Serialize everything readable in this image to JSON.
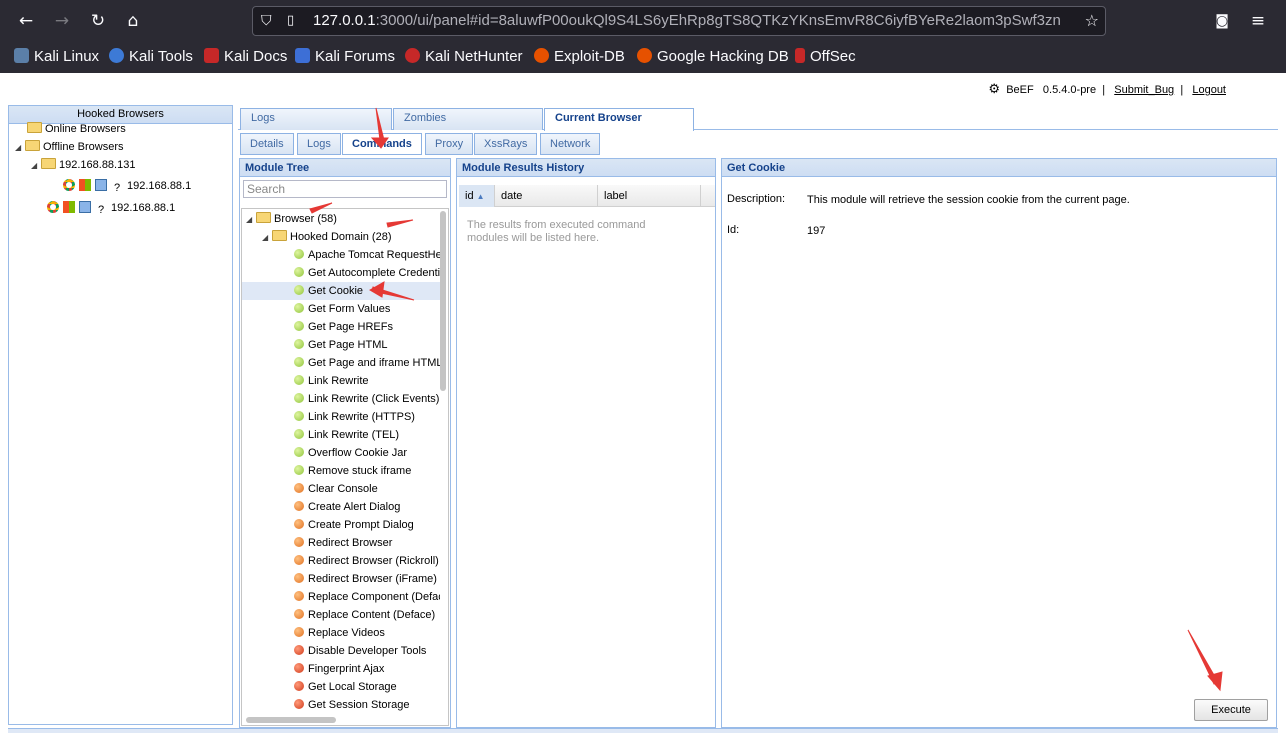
{
  "browser": {
    "url_host": "127.0.0.1",
    "url_rest": ":3000/ui/panel#id=8aluwfP00oukQl9S4LS6yEhRp8gTS8QTKzYKnsEmvR8C6iyfBYeRe2laom3pSwf3zn",
    "bookmarks": [
      "Kali Linux",
      "Kali Tools",
      "Kali Docs",
      "Kali Forums",
      "Kali NetHunter",
      "Exploit-DB",
      "Google Hacking DB",
      "OffSec"
    ],
    "icons": {
      "back": "back-arrow-icon",
      "forward": "forward-arrow-icon",
      "reload": "reload-icon",
      "home": "home-icon",
      "pocket": "pocket-icon",
      "menu": "hamburger-menu-icon"
    }
  },
  "header": {
    "app": "BeEF",
    "version": "0.5.4.0-pre",
    "sep": "|",
    "submit_bug": "Submit_Bug",
    "logout": "Logout"
  },
  "left": {
    "title": "Hooked Browsers",
    "online": "Online Browsers",
    "offline": "Offline Browsers",
    "host": "192.168.88.131",
    "browser1": "192.168.88.1",
    "browser2": "192.168.88.1"
  },
  "tabs": [
    "Logs",
    "Zombies",
    "Current Browser"
  ],
  "subtabs": [
    "Details",
    "Logs",
    "Commands",
    "Proxy",
    "XssRays",
    "Network"
  ],
  "module_tree": {
    "title": "Module Tree",
    "search_placeholder": "Search",
    "root": "Browser (58)",
    "domain": "Hooked Domain (28)",
    "modules": [
      {
        "label": "Apache Tomcat RequestHeaderCookieFilter",
        "color": "green"
      },
      {
        "label": "Get Autocomplete Credentials",
        "color": "green"
      },
      {
        "label": "Get Cookie",
        "color": "green"
      },
      {
        "label": "Get Form Values",
        "color": "green"
      },
      {
        "label": "Get Page HREFs",
        "color": "green"
      },
      {
        "label": "Get Page HTML",
        "color": "green"
      },
      {
        "label": "Get Page and iframe HTML",
        "color": "green"
      },
      {
        "label": "Link Rewrite",
        "color": "green"
      },
      {
        "label": "Link Rewrite (Click Events)",
        "color": "green"
      },
      {
        "label": "Link Rewrite (HTTPS)",
        "color": "green"
      },
      {
        "label": "Link Rewrite (TEL)",
        "color": "green"
      },
      {
        "label": "Overflow Cookie Jar",
        "color": "green"
      },
      {
        "label": "Remove stuck iframe",
        "color": "green"
      },
      {
        "label": "Clear Console",
        "color": "orange"
      },
      {
        "label": "Create Alert Dialog",
        "color": "orange"
      },
      {
        "label": "Create Prompt Dialog",
        "color": "orange"
      },
      {
        "label": "Redirect Browser",
        "color": "orange"
      },
      {
        "label": "Redirect Browser (Rickroll)",
        "color": "orange"
      },
      {
        "label": "Redirect Browser (iFrame)",
        "color": "orange"
      },
      {
        "label": "Replace Component (Deface)",
        "color": "orange"
      },
      {
        "label": "Replace Content (Deface)",
        "color": "orange"
      },
      {
        "label": "Replace Videos",
        "color": "orange"
      },
      {
        "label": "Disable Developer Tools",
        "color": "red"
      },
      {
        "label": "Fingerprint Ajax",
        "color": "red"
      },
      {
        "label": "Get Local Storage",
        "color": "red"
      },
      {
        "label": "Get Session Storage",
        "color": "red"
      }
    ],
    "selected": "Get Cookie"
  },
  "results": {
    "title": "Module Results History",
    "columns": [
      "id",
      "date",
      "label"
    ],
    "empty": "The results from executed command modules will be listed here."
  },
  "detail": {
    "title": "Get Cookie",
    "desc_label": "Description:",
    "desc": "This module will retrieve the session cookie from the current page.",
    "id_label": "Id:",
    "id": "197",
    "execute": "Execute"
  },
  "colors": {
    "annotation_arrow": "#e53935",
    "panel_header": "#15428b"
  }
}
